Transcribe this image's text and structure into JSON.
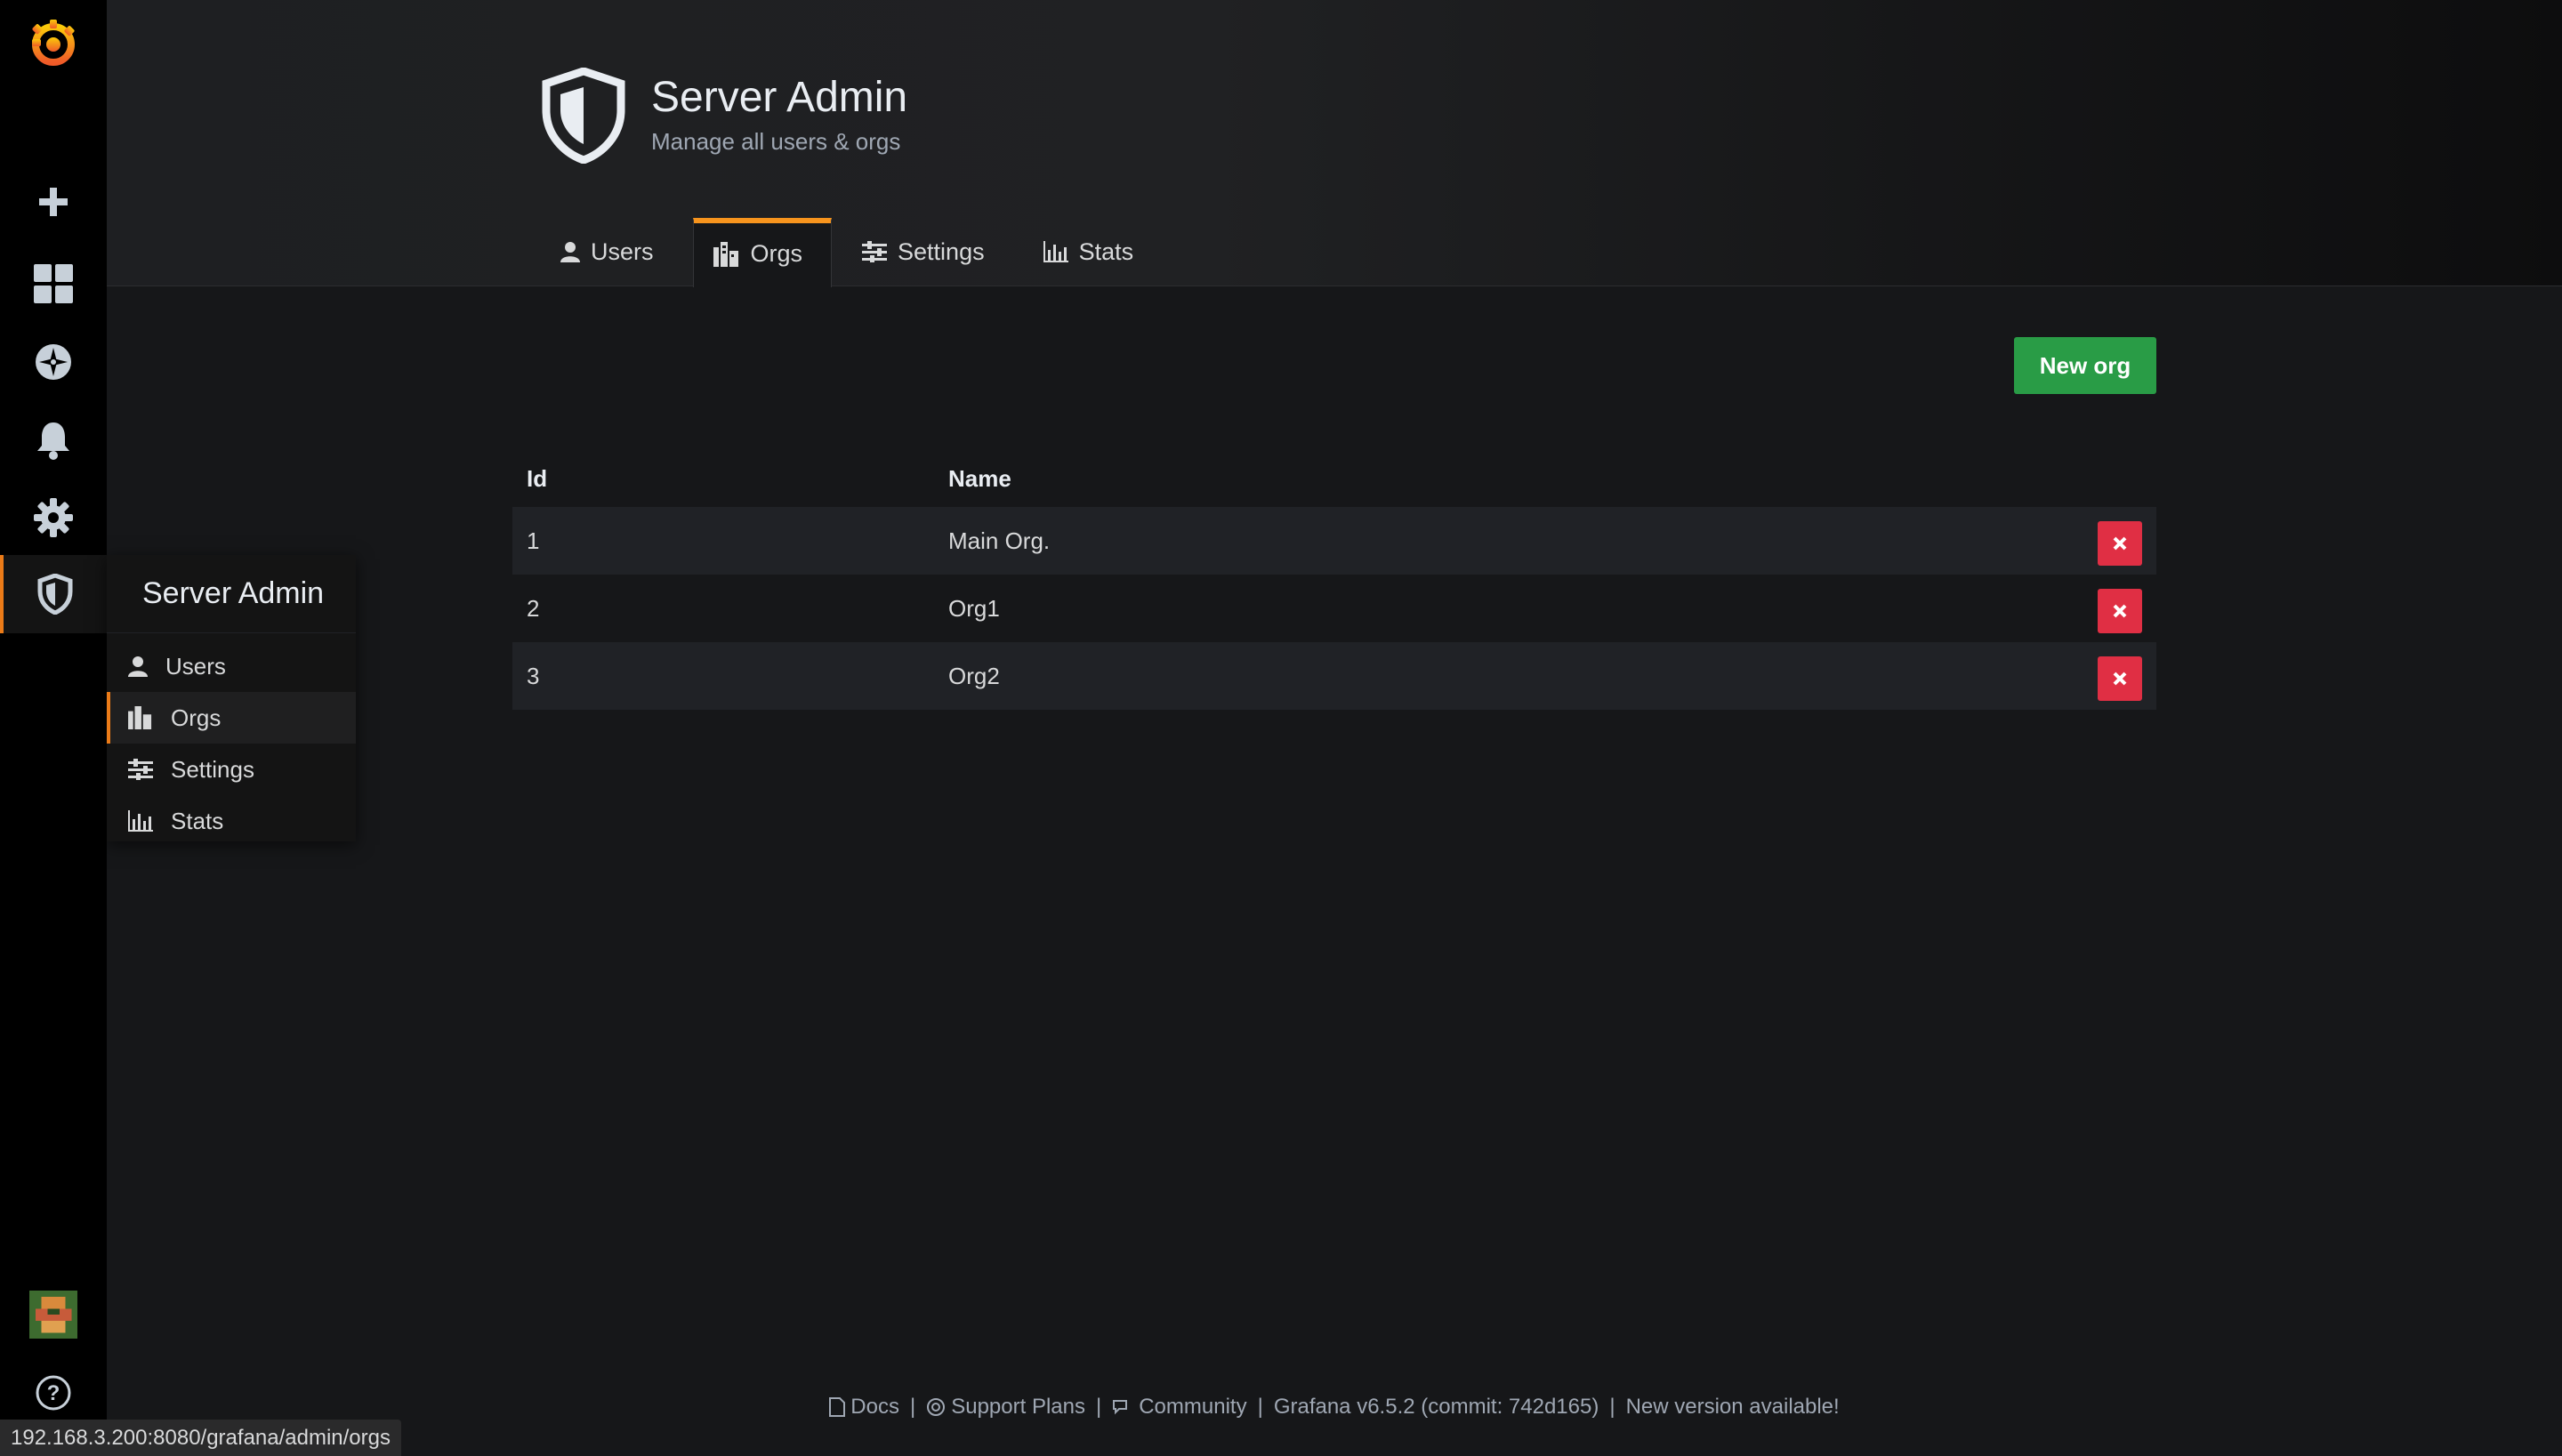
{
  "header": {
    "title": "Server Admin",
    "subtitle": "Manage all users & orgs"
  },
  "tabs": [
    {
      "label": "Users",
      "icon": "user-icon"
    },
    {
      "label": "Orgs",
      "icon": "building-icon",
      "active": true
    },
    {
      "label": "Settings",
      "icon": "sliders-icon"
    },
    {
      "label": "Stats",
      "icon": "bar-chart-icon"
    }
  ],
  "actions": {
    "new_org_label": "New org"
  },
  "table": {
    "columns": {
      "id": "Id",
      "name": "Name"
    },
    "rows": [
      {
        "id": "1",
        "name": "Main Org."
      },
      {
        "id": "2",
        "name": "Org1"
      },
      {
        "id": "3",
        "name": "Org2"
      }
    ]
  },
  "flyout": {
    "title": "Server Admin",
    "items": [
      {
        "label": "Users",
        "icon": "user-icon"
      },
      {
        "label": "Orgs",
        "icon": "building-icon",
        "active": true
      },
      {
        "label": "Settings",
        "icon": "sliders-icon"
      },
      {
        "label": "Stats",
        "icon": "bar-chart-icon"
      }
    ]
  },
  "footer": {
    "docs": "Docs",
    "support": "Support Plans",
    "community": "Community",
    "version": "Grafana v6.5.2 (commit: 742d165)",
    "new_version": "New version available!",
    "separator": "|"
  },
  "status_url": "192.168.3.200:8080/grafana/admin/orgs",
  "colors": {
    "accent": "#eb7b18",
    "primary_button": "#299c46",
    "danger": "#e02f44"
  }
}
